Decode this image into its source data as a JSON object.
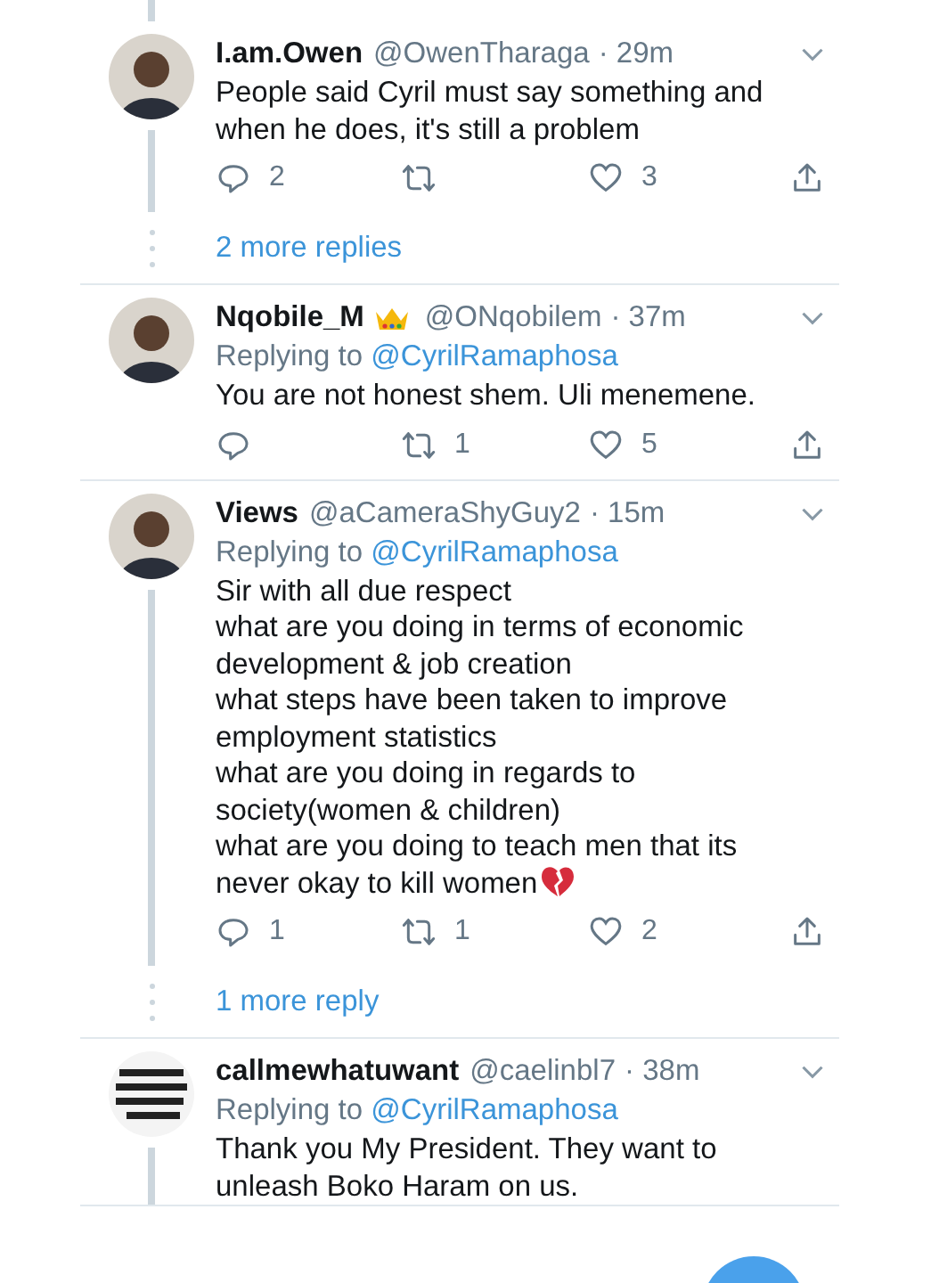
{
  "thread_above": true,
  "threads": [
    {
      "tweets": [
        {
          "avatar": {
            "kind": "person"
          },
          "name": "I.am.Owen",
          "handle": "@OwenTharaga",
          "time": "· 29m",
          "text": "People said Cyril must say something and\nwhen he does, it's still a problem",
          "replies": "2",
          "likes": "3",
          "thread_below": true
        }
      ],
      "more_replies": "2 more replies"
    },
    {
      "tweets": [
        {
          "avatar": {
            "kind": "person"
          },
          "name": "Nqobile_M",
          "crown_badge": true,
          "handle": "@ONqobilem",
          "time": "· 37m",
          "replying_label": "Replying to",
          "replying_to": "@CyrilRamaphosa",
          "text": "You are not honest shem. Uli menemene.",
          "retweets": "1",
          "likes": "5",
          "thread_below": false
        }
      ]
    },
    {
      "tweets": [
        {
          "avatar": {
            "kind": "person"
          },
          "name": "Views",
          "handle": "@aCameraShyGuy2",
          "time": "· 15m",
          "replying_label": "Replying to",
          "replying_to": "@CyrilRamaphosa",
          "text": "Sir with all due respect\nwhat are you doing in terms of economic\ndevelopment & job creation\nwhat steps have been taken to improve\nemployment statistics\nwhat are you doing in regards to\nsociety(women & children)\nwhat are you doing to teach men that its\nnever okay to kill women",
          "trailing_heart_icon": true,
          "replies": "1",
          "retweets": "1",
          "likes": "2",
          "thread_below": true
        }
      ],
      "more_replies": "1 more reply"
    },
    {
      "tweets": [
        {
          "name": "callmewhatuwant",
          "handle": "@caelinbl7",
          "time": "· 38m",
          "replying_label": "Replying to",
          "replying_to": "@CyrilRamaphosa",
          "text": "Thank you My President. They want to\nunleash Boko Haram on us.",
          "thread_below": true,
          "cut_off": true
        }
      ]
    }
  ]
}
